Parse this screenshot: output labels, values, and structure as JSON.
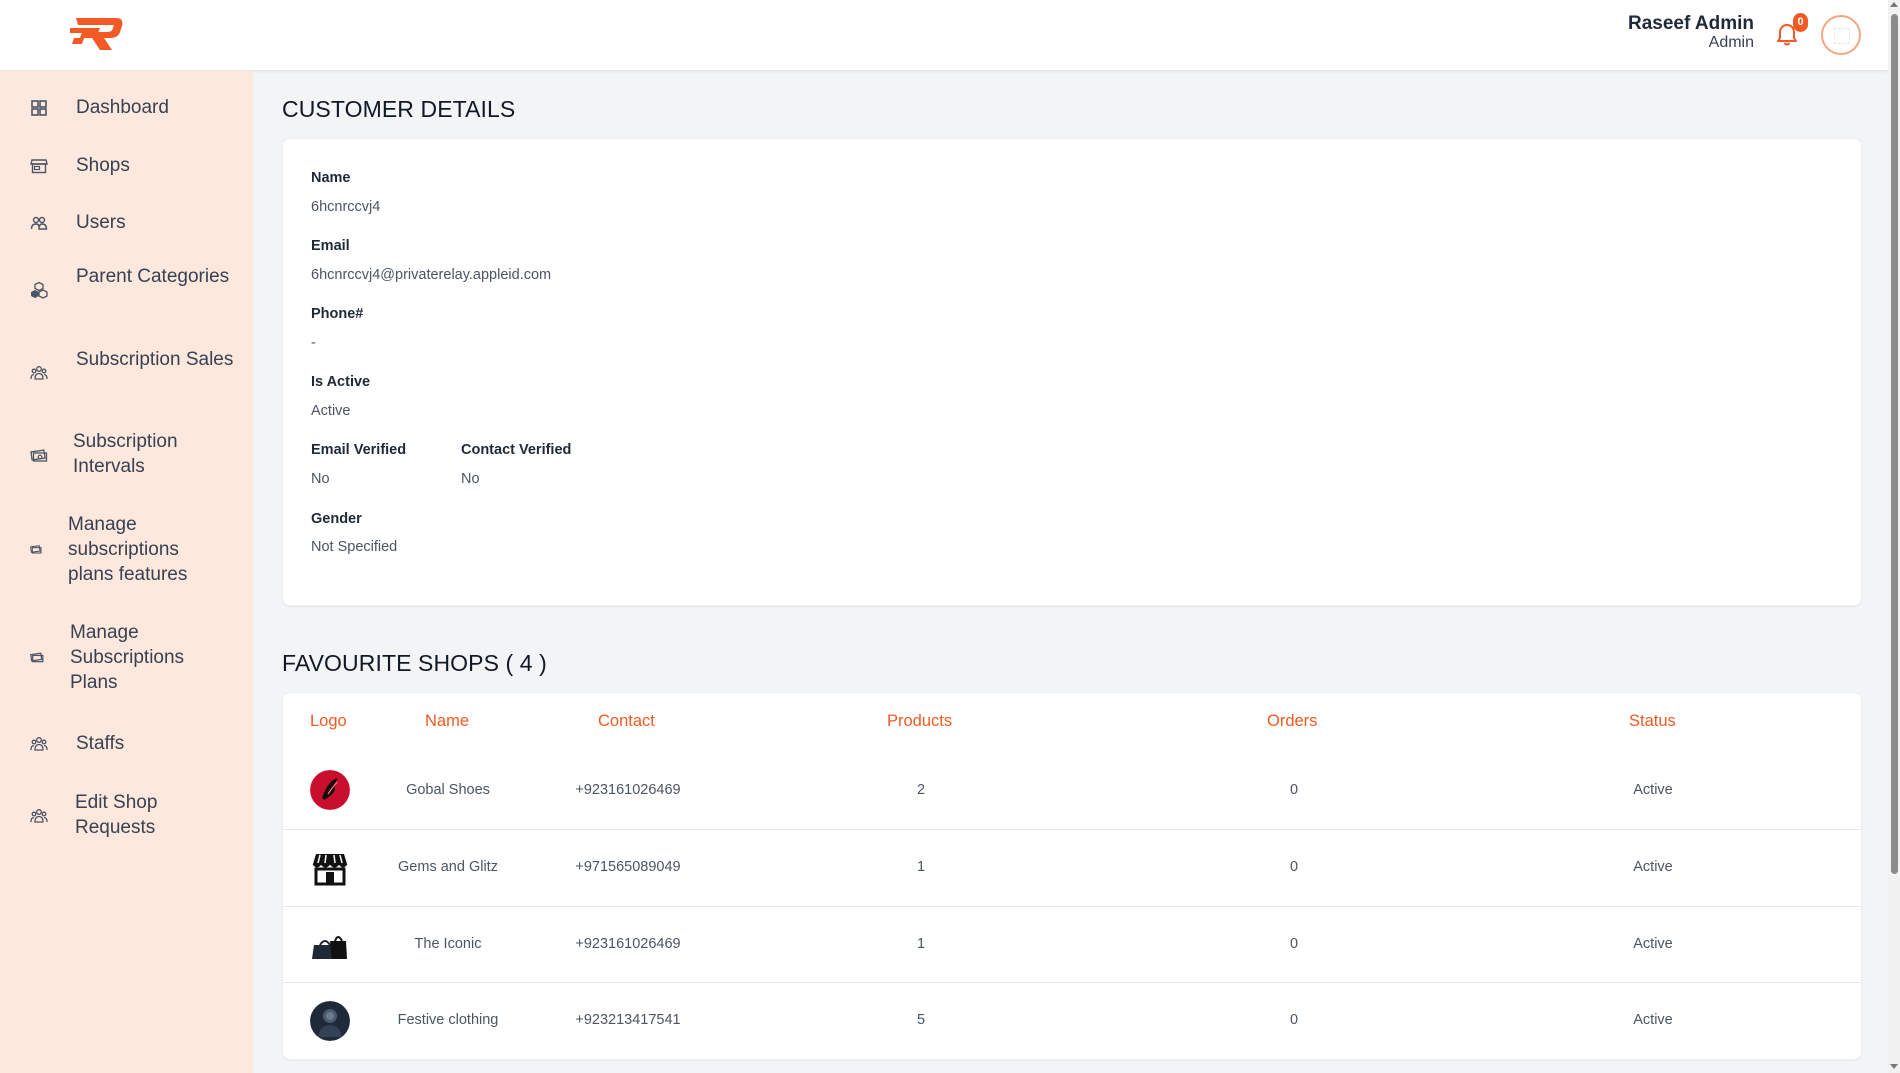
{
  "header": {
    "user_name": "Raseef Admin",
    "user_role": "Admin",
    "notification_count": "0",
    "brand_color": "#f15a24"
  },
  "sidebar": {
    "items": [
      {
        "label": "Dashboard",
        "icon": "grid-icon"
      },
      {
        "label": "Shops",
        "icon": "store-icon"
      },
      {
        "label": "Users",
        "icon": "users-icon"
      },
      {
        "label": "Parent Categories",
        "icon": "cubes-icon"
      },
      {
        "label": "Subscription Sales",
        "icon": "group-icon"
      },
      {
        "label": "Subscription Intervals",
        "icon": "money-icon"
      },
      {
        "label": "Manage subscriptions plans features",
        "icon": "money-icon"
      },
      {
        "label": "Manage Subscriptions Plans",
        "icon": "money-icon"
      },
      {
        "label": "Staffs",
        "icon": "group-icon"
      },
      {
        "label": "Edit Shop Requests",
        "icon": "group-icon"
      }
    ]
  },
  "customer": {
    "title": "CUSTOMER DETAILS",
    "name_label": "Name",
    "name_value": "6hcnrccvj4",
    "email_label": "Email",
    "email_value": "6hcnrccvj4@privaterelay.appleid.com",
    "phone_label": "Phone#",
    "phone_value": "-",
    "active_label": "Is Active",
    "active_value": "Active",
    "email_verified_label": "Email Verified",
    "email_verified_value": "No",
    "contact_verified_label": "Contact Verified",
    "contact_verified_value": "No",
    "gender_label": "Gender",
    "gender_value": "Not Specified"
  },
  "favourites": {
    "title": "FAVOURITE SHOPS ( 4 )",
    "columns": [
      "Logo",
      "Name",
      "Contact",
      "Products",
      "Orders",
      "Status"
    ],
    "rows": [
      {
        "logo": "red-shoe-logo",
        "name": "Gobal Shoes",
        "contact": "+923161026469",
        "products": "2",
        "orders": "0",
        "status": "Active"
      },
      {
        "logo": "store-front-logo",
        "name": "Gems and Glitz",
        "contact": "+971565089049",
        "products": "1",
        "orders": "0",
        "status": "Active"
      },
      {
        "logo": "bags-logo",
        "name": "The Iconic",
        "contact": "+923161026469",
        "products": "1",
        "orders": "0",
        "status": "Active"
      },
      {
        "logo": "portrait-logo",
        "name": "Festive clothing",
        "contact": "+923213417541",
        "products": "5",
        "orders": "0",
        "status": "Active"
      }
    ]
  }
}
